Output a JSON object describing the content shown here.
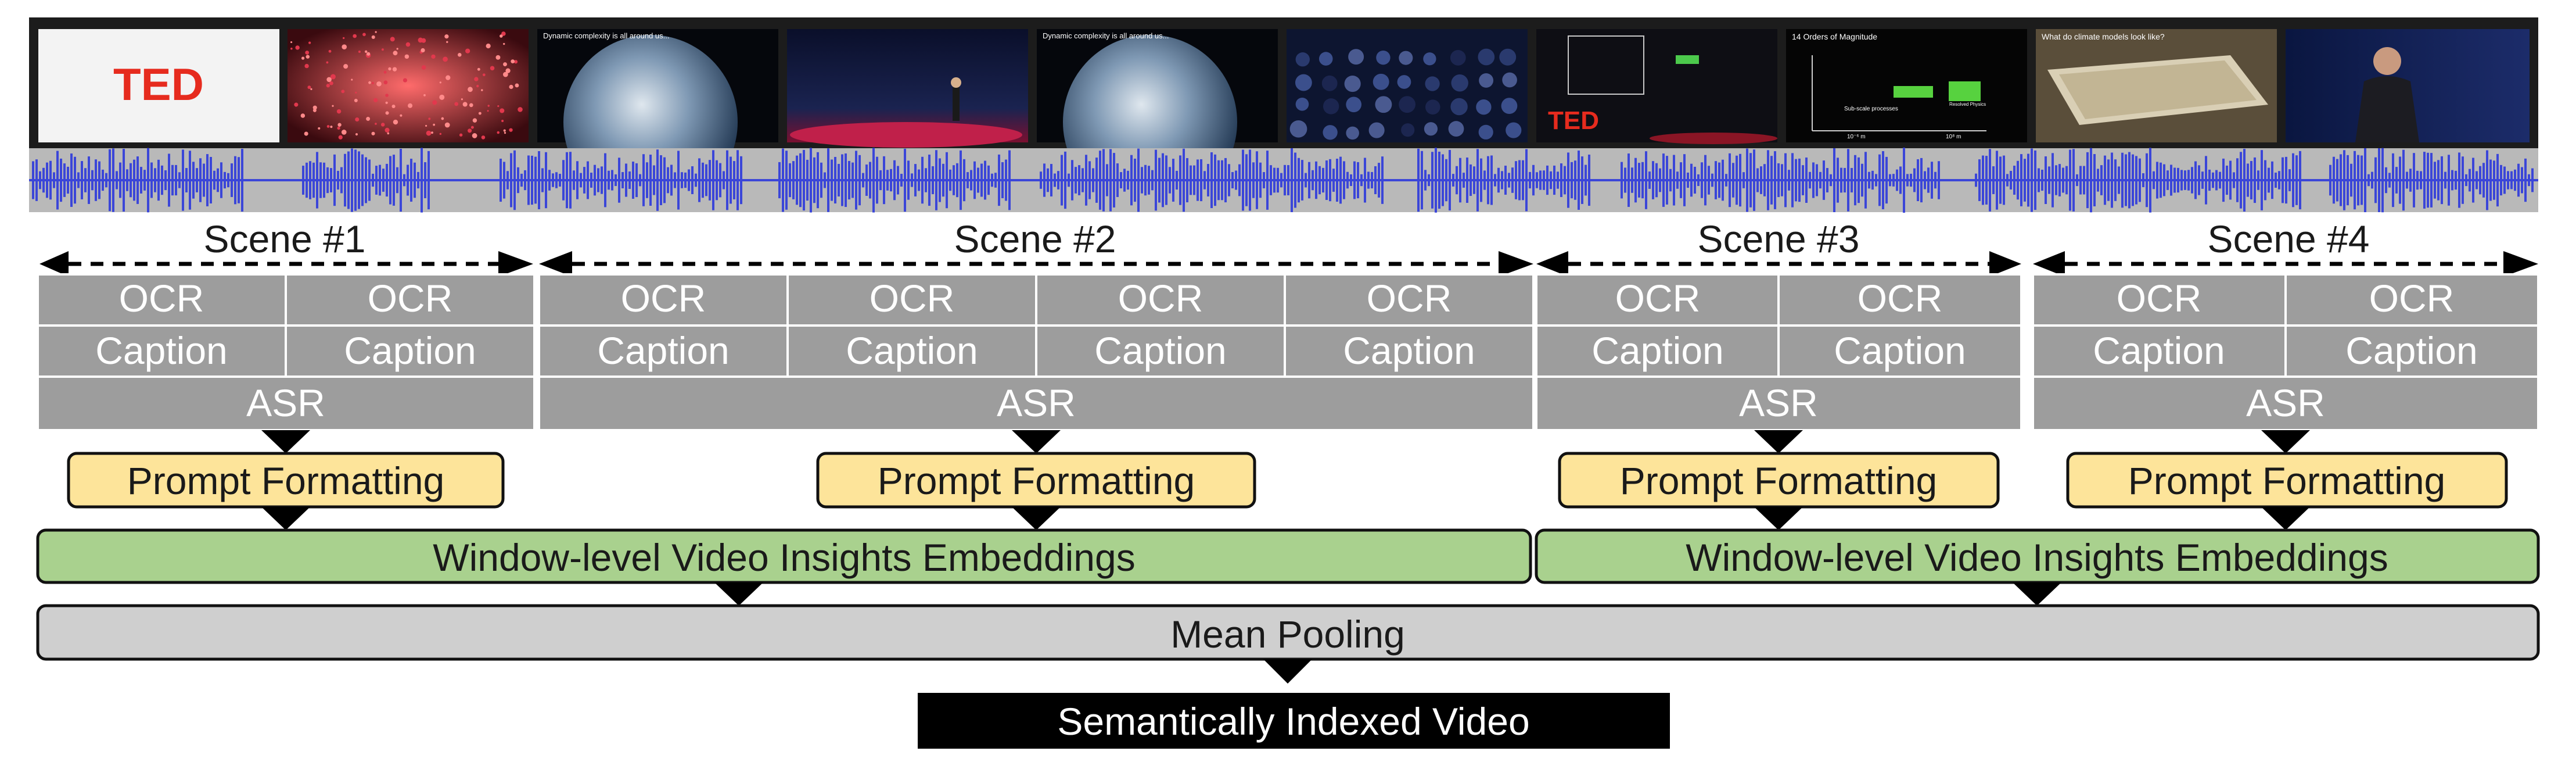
{
  "thumbnails": [
    {
      "kind": "ted-logo",
      "text": "TED"
    },
    {
      "kind": "particles",
      "text": ""
    },
    {
      "kind": "earth",
      "text": "Dynamic complexity is all around us..."
    },
    {
      "kind": "stage",
      "text": ""
    },
    {
      "kind": "earth",
      "text": "Dynamic complexity is all around us..."
    },
    {
      "kind": "audience",
      "text": ""
    },
    {
      "kind": "stage-ted",
      "text": "TED",
      "caption": "14 Orders of Magnitude"
    },
    {
      "kind": "plot",
      "text": "14 Orders of Magnitude",
      "inner": [
        "Sub-scale processes",
        "Resolved Physics",
        "10⁻⁶ m",
        "10⁸ m"
      ]
    },
    {
      "kind": "keyboard",
      "text": "What do climate models look like?"
    },
    {
      "kind": "speaker",
      "text": ""
    }
  ],
  "scenes": [
    {
      "label": "Scene #1",
      "columns": 2,
      "ocr_label": "OCR",
      "caption_label": "Caption",
      "asr_label": "ASR",
      "prompt_label": "Prompt Formatting"
    },
    {
      "label": "Scene #2",
      "columns": 4,
      "ocr_label": "OCR",
      "caption_label": "Caption",
      "asr_label": "ASR",
      "prompt_label": "Prompt Formatting"
    },
    {
      "label": "Scene #3",
      "columns": 2,
      "ocr_label": "OCR",
      "caption_label": "Caption",
      "asr_label": "ASR",
      "prompt_label": "Prompt Formatting"
    },
    {
      "label": "Scene #4",
      "columns": 2,
      "ocr_label": "OCR",
      "caption_label": "Caption",
      "asr_label": "ASR",
      "prompt_label": "Prompt Formatting"
    }
  ],
  "embeddings": [
    {
      "label": "Window-level Video Insights Embeddings"
    },
    {
      "label": "Window-level Video Insights Embeddings"
    }
  ],
  "pooling": {
    "label": "Mean Pooling"
  },
  "output": {
    "label": "Semantically Indexed Video"
  },
  "colors": {
    "thumb_strip": "#1c1c1c",
    "waveform": "#3b46d8",
    "waveform_bg": "#b9b9b9",
    "cell": "#9d9d9d",
    "prompt": "#fde49a",
    "embedding": "#a9d18e",
    "pooling": "#cfcfcf",
    "output": "#000000"
  }
}
